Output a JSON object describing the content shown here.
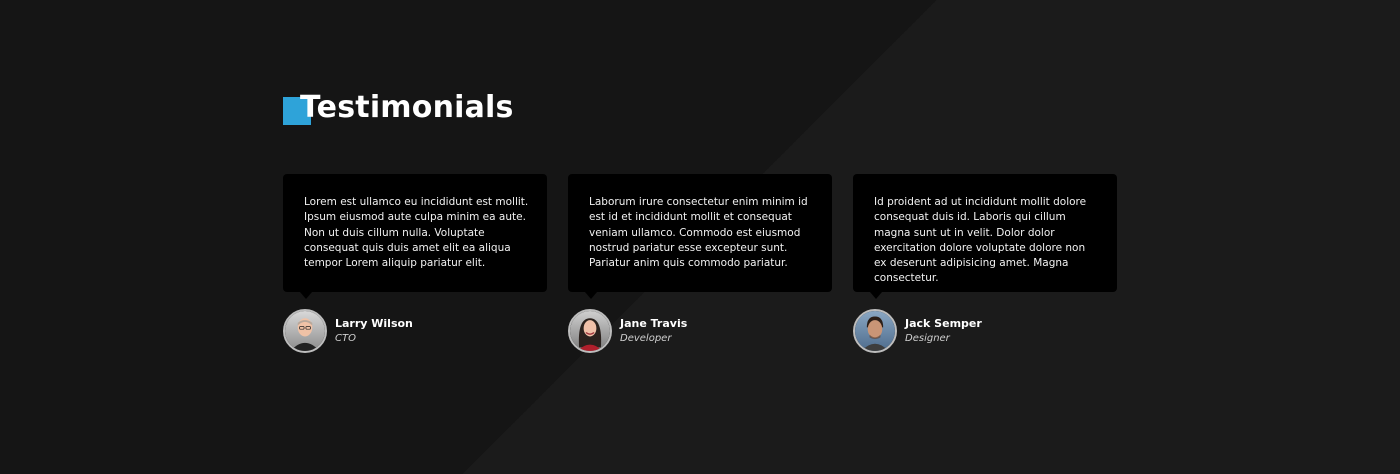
{
  "section": {
    "title": "Testimonials",
    "accent_color": "#2ea3d9"
  },
  "testimonials": [
    {
      "quote": "Lorem est ullamco eu incididunt est mollit. Ipsum eiusmod aute culpa minim ea aute. Non ut duis cillum nulla. Voluptate consequat quis duis amet elit ea aliqua tempor Lorem aliquip pariatur elit.",
      "name": "Larry Wilson",
      "role": "CTO"
    },
    {
      "quote": "Laborum irure consectetur enim minim id est id et incididunt mollit et consequat veniam ullamco. Commodo est eiusmod nostrud pariatur esse excepteur sunt. Pariatur anim quis commodo pariatur.",
      "name": "Jane Travis",
      "role": "Developer"
    },
    {
      "quote": "Id proident ad ut incididunt mollit dolore consequat duis id. Laboris qui cillum magna sunt ut in velit. Dolor dolor exercitation dolore voluptate dolore non ex deserunt adipisicing amet. Magna consectetur.",
      "name": "Jack Semper",
      "role": "Designer"
    }
  ]
}
